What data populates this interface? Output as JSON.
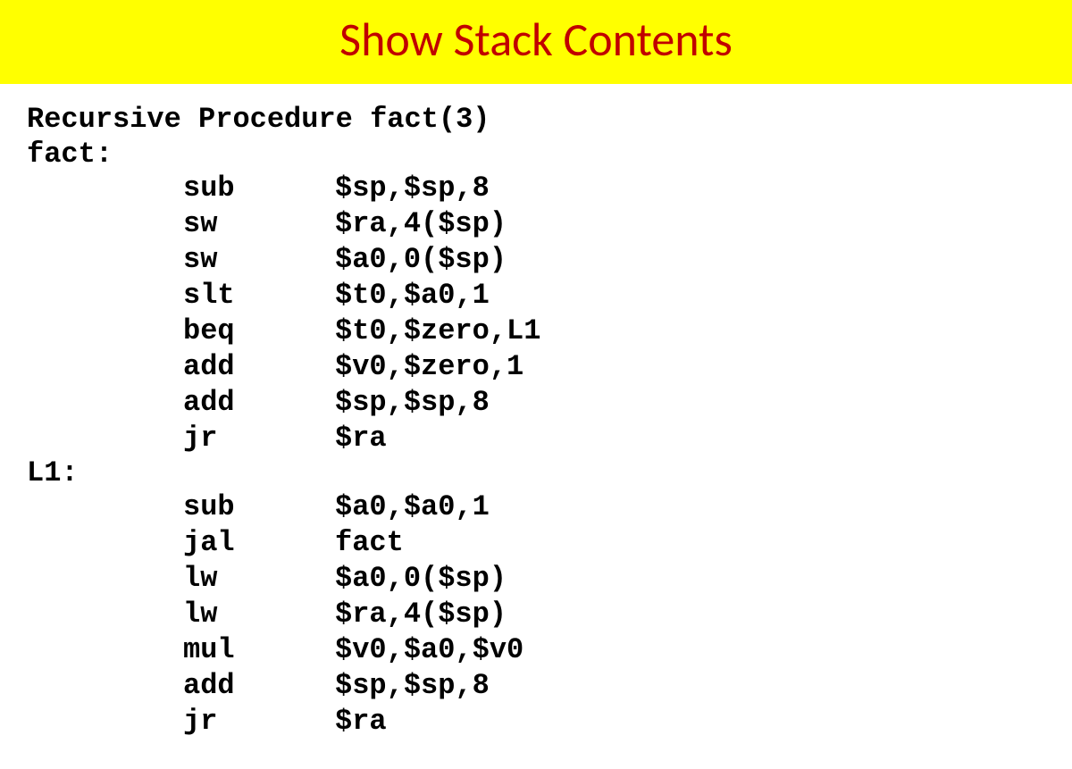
{
  "title": "Show Stack Contents",
  "heading": "Recursive Procedure fact(3)",
  "label1": "fact:",
  "label2": "L1:",
  "block1": [
    {
      "op": "sub",
      "args": "$sp,$sp,8"
    },
    {
      "op": "sw",
      "args": "$ra,4($sp)"
    },
    {
      "op": "sw",
      "args": "$a0,0($sp)"
    },
    {
      "op": "slt",
      "args": "$t0,$a0,1"
    },
    {
      "op": "beq",
      "args": "$t0,$zero,L1"
    },
    {
      "op": "add",
      "args": "$v0,$zero,1"
    },
    {
      "op": "add",
      "args": "$sp,$sp,8"
    },
    {
      "op": "jr",
      "args": "$ra"
    }
  ],
  "block2": [
    {
      "op": "sub",
      "args": "$a0,$a0,1"
    },
    {
      "op": "jal",
      "args": "fact"
    },
    {
      "op": "lw",
      "args": "$a0,0($sp)"
    },
    {
      "op": "lw",
      "args": "$ra,4($sp)"
    },
    {
      "op": "mul",
      "args": "$v0,$a0,$v0"
    },
    {
      "op": "add",
      "args": "$sp,$sp,8"
    },
    {
      "op": "jr",
      "args": "$ra"
    }
  ]
}
